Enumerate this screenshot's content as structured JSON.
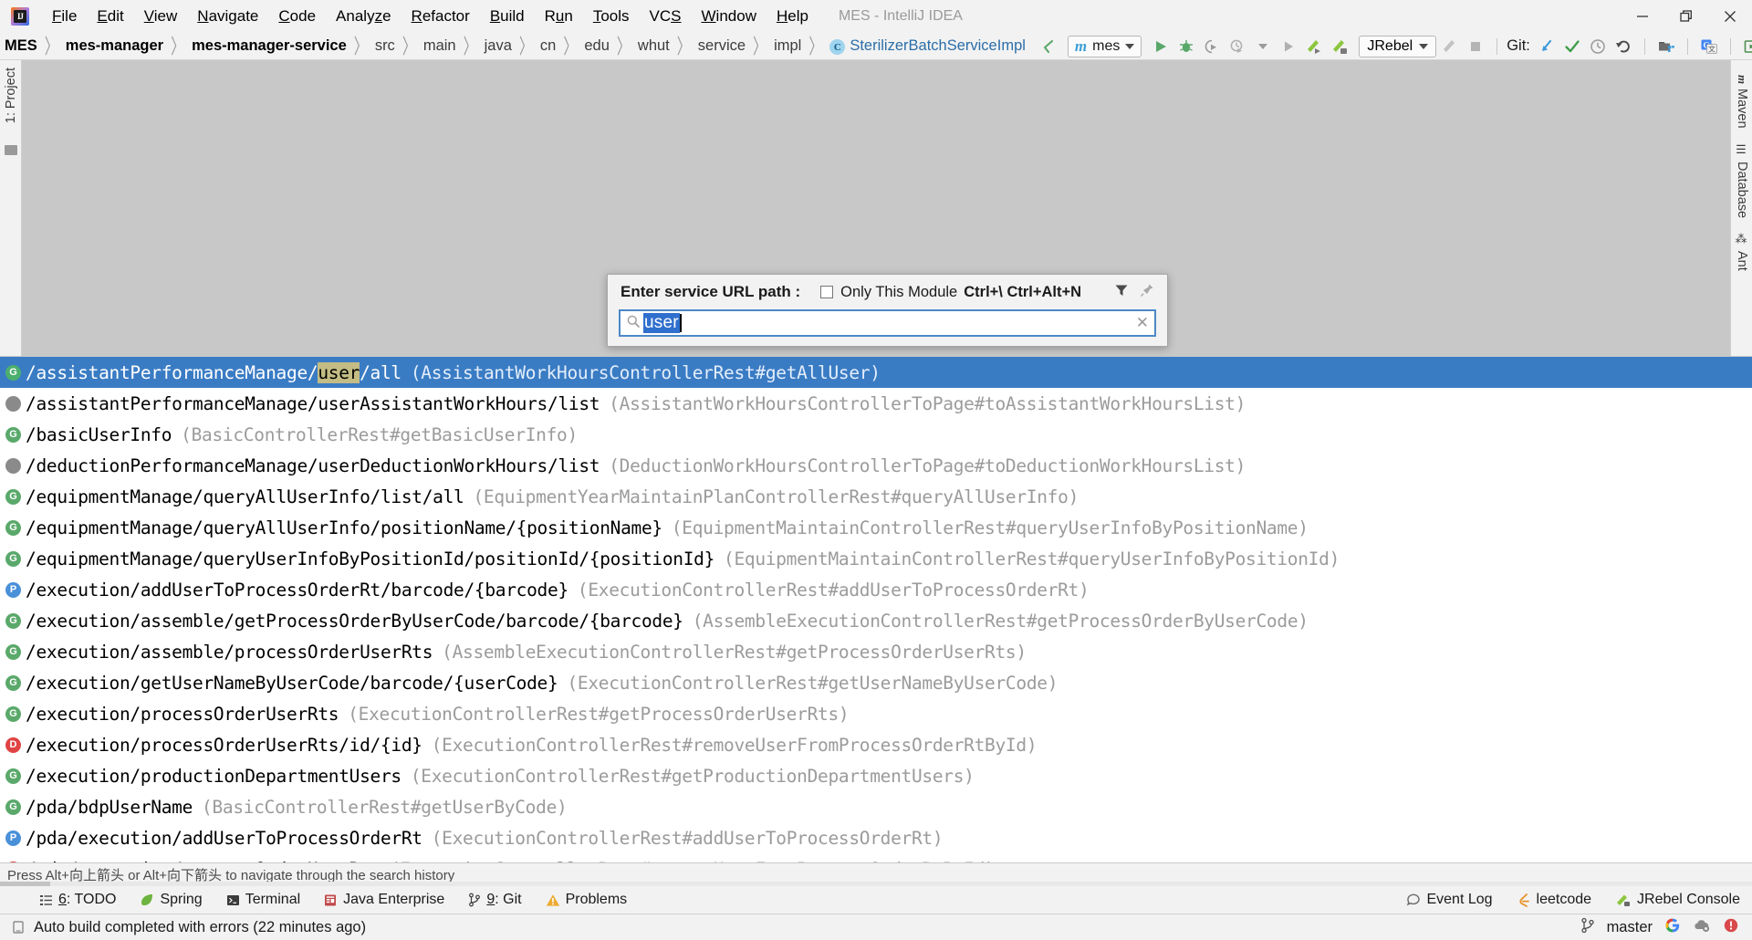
{
  "window": {
    "title": "MES - IntelliJ IDEA",
    "logo_text": "IJ",
    "controls": {
      "minimize": "minimize-icon",
      "maximize": "maximize-icon",
      "close": "close-icon"
    }
  },
  "menubar": {
    "items": [
      {
        "label": "File",
        "mnemonic": "F"
      },
      {
        "label": "Edit",
        "mnemonic": "E"
      },
      {
        "label": "View",
        "mnemonic": "V"
      },
      {
        "label": "Navigate",
        "mnemonic": "N"
      },
      {
        "label": "Code",
        "mnemonic": "C"
      },
      {
        "label": "Analyze",
        "mnemonic": "z"
      },
      {
        "label": "Refactor",
        "mnemonic": "R"
      },
      {
        "label": "Build",
        "mnemonic": "B"
      },
      {
        "label": "Run",
        "mnemonic": "u"
      },
      {
        "label": "Tools",
        "mnemonic": "T"
      },
      {
        "label": "VCS",
        "mnemonic": "S"
      },
      {
        "label": "Window",
        "mnemonic": "W"
      },
      {
        "label": "Help",
        "mnemonic": "H"
      }
    ]
  },
  "breadcrumb": {
    "items": [
      "MES",
      "mes-manager",
      "mes-manager-service",
      "src",
      "main",
      "java",
      "cn",
      "edu",
      "whut",
      "service",
      "impl"
    ],
    "bold_indices": [
      0,
      1,
      2
    ],
    "class_badge": "C",
    "class_name": "SterilizerBatchServiceImpl",
    "separator": "〉"
  },
  "toolbar": {
    "back_icon": "back-arrow-icon",
    "run_config": {
      "prefix": "m",
      "name": "mes"
    },
    "run_icon": "run-icon",
    "debug_icon": "debug-icon",
    "coverage_icon": "run-with-coverage-icon",
    "profile_icon": "profile-icon",
    "more_run_icon": "run-dropdown-icon",
    "jrebel_run_icon": "jrebel-run-icon",
    "jrebel_debug_icon": "jrebel-debug-icon",
    "jrebel_label": "JRebel",
    "stop_icon": "stop-icon",
    "git_label": "Git:",
    "update_project_icon": "update-project-icon",
    "commit_icon": "commit-checkmark-icon",
    "history_icon": "history-clock-icon",
    "revert_icon": "revert-icon",
    "project_structure_icon": "project-structure-icon",
    "translate_icon": "google-translate-icon",
    "tool_window_icon": "tool-window-icon",
    "search_everywhere_icon": "search-icon"
  },
  "left_stripe": {
    "items": [
      {
        "label": "1: Project",
        "icon": "project-icon"
      }
    ]
  },
  "right_stripe": {
    "items": [
      {
        "label": "Maven",
        "icon": "maven-icon",
        "glyph": "m"
      },
      {
        "label": "Database",
        "icon": "database-icon",
        "glyph": "☰"
      },
      {
        "label": "Ant",
        "icon": "ant-icon",
        "glyph": "⁂"
      }
    ]
  },
  "popup": {
    "title": "Enter service URL path :",
    "only_this_module": {
      "label": "Only This Module",
      "checked": false
    },
    "shortcut": "Ctrl+\\ Ctrl+Alt+N",
    "filter_icon": "filter-icon",
    "pin_icon": "pin-icon",
    "search": {
      "value": "user",
      "placeholder": "",
      "selected": true,
      "search_icon": "search-icon",
      "clear_icon": "clear-icon"
    }
  },
  "results": {
    "selected_index": 0,
    "rows": [
      {
        "method": "G",
        "path_before": "/assistantPerformanceManage/",
        "path_match": "user",
        "path_after": "/all",
        "meta": "(AssistantWorkHoursControllerRest#getAllUser)"
      },
      {
        "method": "N",
        "path_before": "/assistantPerformanceManage/userAssistantWorkHours/list",
        "path_match": "",
        "path_after": "",
        "meta": "(AssistantWorkHoursControllerToPage#toAssistantWorkHoursList)"
      },
      {
        "method": "G",
        "path_before": "/basicUserInfo",
        "path_match": "",
        "path_after": "",
        "meta": "(BasicControllerRest#getBasicUserInfo)"
      },
      {
        "method": "N",
        "path_before": "/deductionPerformanceManage/userDeductionWorkHours/list",
        "path_match": "",
        "path_after": "",
        "meta": "(DeductionWorkHoursControllerToPage#toDeductionWorkHoursList)"
      },
      {
        "method": "G",
        "path_before": "/equipmentManage/queryAllUserInfo/list/all",
        "path_match": "",
        "path_after": "",
        "meta": "(EquipmentYearMaintainPlanControllerRest#queryAllUserInfo)"
      },
      {
        "method": "G",
        "path_before": "/equipmentManage/queryAllUserInfo/positionName/{positionName}",
        "path_match": "",
        "path_after": "",
        "meta": "(EquipmentMaintainControllerRest#queryUserInfoByPositionName)"
      },
      {
        "method": "G",
        "path_before": "/equipmentManage/queryUserInfoByPositionId/positionId/{positionId}",
        "path_match": "",
        "path_after": "",
        "meta": "(EquipmentMaintainControllerRest#queryUserInfoByPositionId)"
      },
      {
        "method": "P",
        "path_before": "/execution/addUserToProcessOrderRt/barcode/{barcode}",
        "path_match": "",
        "path_after": "",
        "meta": "(ExecutionControllerRest#addUserToProcessOrderRt)"
      },
      {
        "method": "G",
        "path_before": "/execution/assemble/getProcessOrderByUserCode/barcode/{barcode}",
        "path_match": "",
        "path_after": "",
        "meta": "(AssembleExecutionControllerRest#getProcessOrderByUserCode)"
      },
      {
        "method": "G",
        "path_before": "/execution/assemble/processOrderUserRts",
        "path_match": "",
        "path_after": "",
        "meta": "(AssembleExecutionControllerRest#getProcessOrderUserRts)"
      },
      {
        "method": "G",
        "path_before": "/execution/getUserNameByUserCode/barcode/{userCode}",
        "path_match": "",
        "path_after": "",
        "meta": "(ExecutionControllerRest#getUserNameByUserCode)"
      },
      {
        "method": "G",
        "path_before": "/execution/processOrderUserRts",
        "path_match": "",
        "path_after": "",
        "meta": "(ExecutionControllerRest#getProcessOrderUserRts)"
      },
      {
        "method": "D",
        "path_before": "/execution/processOrderUserRts/id/{id}",
        "path_match": "",
        "path_after": "",
        "meta": "(ExecutionControllerRest#removeUserFromProcessOrderRtById)"
      },
      {
        "method": "G",
        "path_before": "/execution/productionDepartmentUsers",
        "path_match": "",
        "path_after": "",
        "meta": "(ExecutionControllerRest#getProductionDepartmentUsers)"
      },
      {
        "method": "G",
        "path_before": "/pda/bdpUserName",
        "path_match": "",
        "path_after": "",
        "meta": "(BasicControllerRest#getUserByCode)"
      },
      {
        "method": "P",
        "path_before": "/pda/execution/addUserToProcessOrderRt",
        "path_match": "",
        "path_after": "",
        "meta": "(ExecutionControllerRest#addUserToProcessOrderRt)"
      },
      {
        "method": "D",
        "path_before": "/pda/execution/processOrderUserRts",
        "path_match": "",
        "path_after": "",
        "meta": "(ExecutionControllerRest#removeUserFromProcessOrderRtById)"
      }
    ]
  },
  "hint": {
    "text": "Press Alt+向上箭头 or Alt+向下箭头 to navigate through the search history"
  },
  "tool_windows": {
    "left_items": [
      {
        "label": "6: TODO",
        "mnemonic": "6",
        "icon": "todo-icon"
      },
      {
        "label": "Spring",
        "mnemonic": "",
        "icon": "spring-leaf-icon"
      },
      {
        "label": "Terminal",
        "mnemonic": "",
        "icon": "terminal-icon"
      },
      {
        "label": "Java Enterprise",
        "mnemonic": "",
        "icon": "java-enterprise-icon"
      },
      {
        "label": "9: Git",
        "mnemonic": "9",
        "icon": "git-branch-icon"
      },
      {
        "label": "Problems",
        "mnemonic": "",
        "icon": "warning-triangle-icon"
      }
    ],
    "right_items": [
      {
        "label": "Event Log",
        "icon": "event-log-icon"
      },
      {
        "label": "leetcode",
        "icon": "leetcode-icon"
      },
      {
        "label": "JRebel Console",
        "icon": "jrebel-icon"
      }
    ]
  },
  "statusbar": {
    "message": "Auto build completed with errors (22 minutes ago)",
    "message_icon": "memory-icon",
    "branch": "master",
    "branch_icon": "git-branch-icon",
    "google_icon": "google-icon",
    "settings_icon": "settings-cloud-icon",
    "error_icon": "error-icon"
  },
  "colors": {
    "accent_blue": "#3a7cc4",
    "get_green": "#5aa96b",
    "post_blue": "#4a90d9",
    "delete_red": "#e04343",
    "neutral_gray": "#8a8a8a",
    "highlight_match": "#c8c08a",
    "editor_bg": "#c8c8c8",
    "chrome_bg": "#f2f2f2"
  }
}
